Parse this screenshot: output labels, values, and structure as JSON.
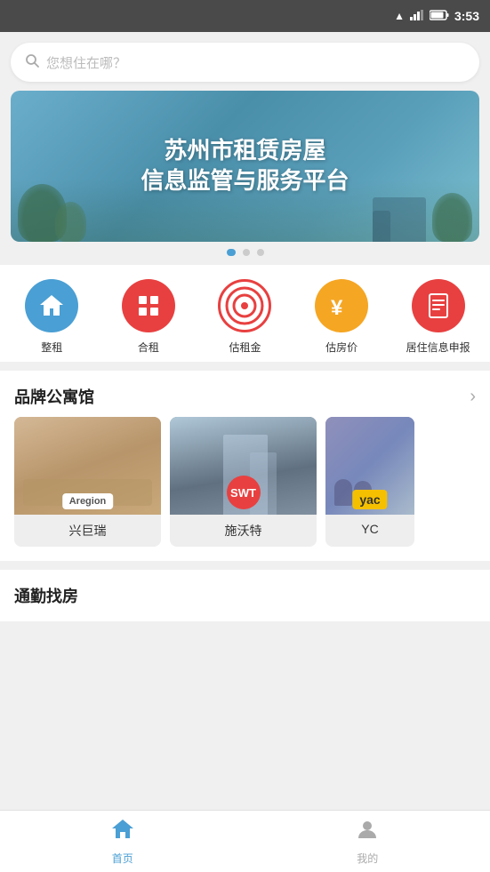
{
  "statusBar": {
    "time": "3:53",
    "icons": [
      "wifi",
      "signal",
      "battery"
    ]
  },
  "search": {
    "placeholder": "您想住在哪？"
  },
  "banner": {
    "slides": [
      {
        "line1": "苏州市租赁房屋",
        "line2": "信息监管与服务平台"
      }
    ],
    "dots": [
      true,
      false,
      false
    ]
  },
  "categories": [
    {
      "id": "zhengzu",
      "label": "整租",
      "icon": "🏠",
      "color": "blue"
    },
    {
      "id": "hezi",
      "label": "合租",
      "icon": "🏢",
      "color": "red"
    },
    {
      "id": "guzujin",
      "label": "估租金",
      "icon": "◎",
      "color": "orange-outline"
    },
    {
      "id": "gufangjia",
      "label": "估房价",
      "icon": "¥",
      "color": "orange"
    },
    {
      "id": "juzhuinfo",
      "label": "居住信息申报",
      "icon": "🏛",
      "color": "red2"
    }
  ],
  "brandSection": {
    "title": "品牌公寓馆",
    "arrowLabel": "›",
    "hotels": [
      {
        "id": "xingju",
        "name": "兴巨瑞",
        "logo": "Aregion",
        "bgType": "warm"
      },
      {
        "id": "shiwote",
        "name": "施沃特",
        "logo": "SWT",
        "bgType": "cool"
      },
      {
        "id": "yc",
        "name": "YC",
        "logo": "yac",
        "bgType": "purple"
      }
    ]
  },
  "commuteSection": {
    "title": "通勤找房"
  },
  "bottomNav": [
    {
      "id": "home",
      "label": "首页",
      "icon": "home",
      "active": true
    },
    {
      "id": "mine",
      "label": "我的",
      "icon": "person",
      "active": false
    }
  ]
}
